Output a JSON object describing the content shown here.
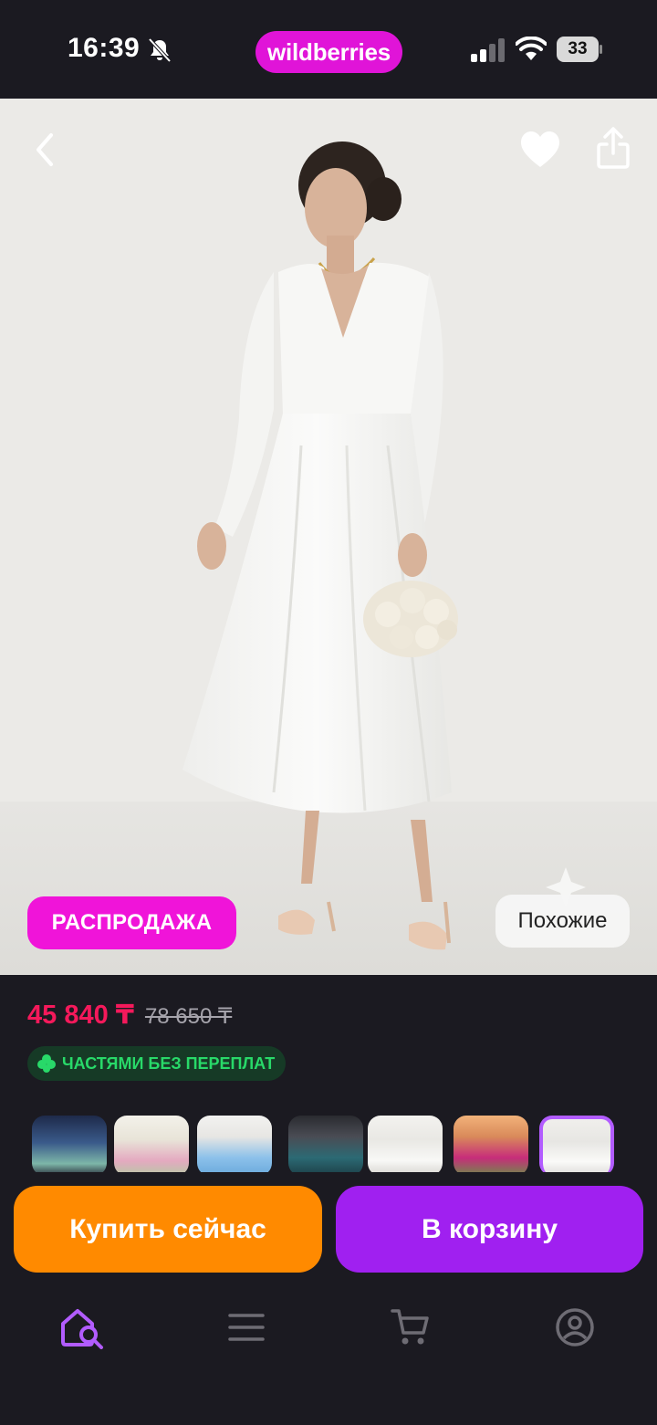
{
  "status_bar": {
    "time": "16:39",
    "brand": "wildberries",
    "battery": "33",
    "icons": [
      "bell-slash-icon",
      "signal-icon",
      "wifi-icon",
      "battery-icon"
    ]
  },
  "hero": {
    "sale_badge": "РАСПРОДАЖА",
    "similar_label": "Похожие",
    "icons": [
      "back-chevron-icon",
      "heart-icon",
      "share-icon"
    ]
  },
  "price": {
    "current": "45 840 ₸",
    "old": "78 650 ₸"
  },
  "installments": {
    "label": "ЧАСТЯМИ БЕЗ ПЕРЕПЛАТ",
    "icon": "clover-icon"
  },
  "thumbnails": {
    "count": 7,
    "active_index": 6
  },
  "actions": {
    "buy_now": "Купить сейчас",
    "add_to_cart": "В корзину"
  },
  "bottom_nav": {
    "items": [
      "home-search-icon",
      "menu-icon",
      "cart-icon",
      "profile-icon"
    ],
    "active": "home-search-icon"
  },
  "colors": {
    "brand": "#e014d8",
    "price": "#f5195b",
    "buy_now": "#ff8a00",
    "add_to_cart": "#a020f0",
    "installments_text": "#28d969",
    "background": "#1b1a21"
  }
}
